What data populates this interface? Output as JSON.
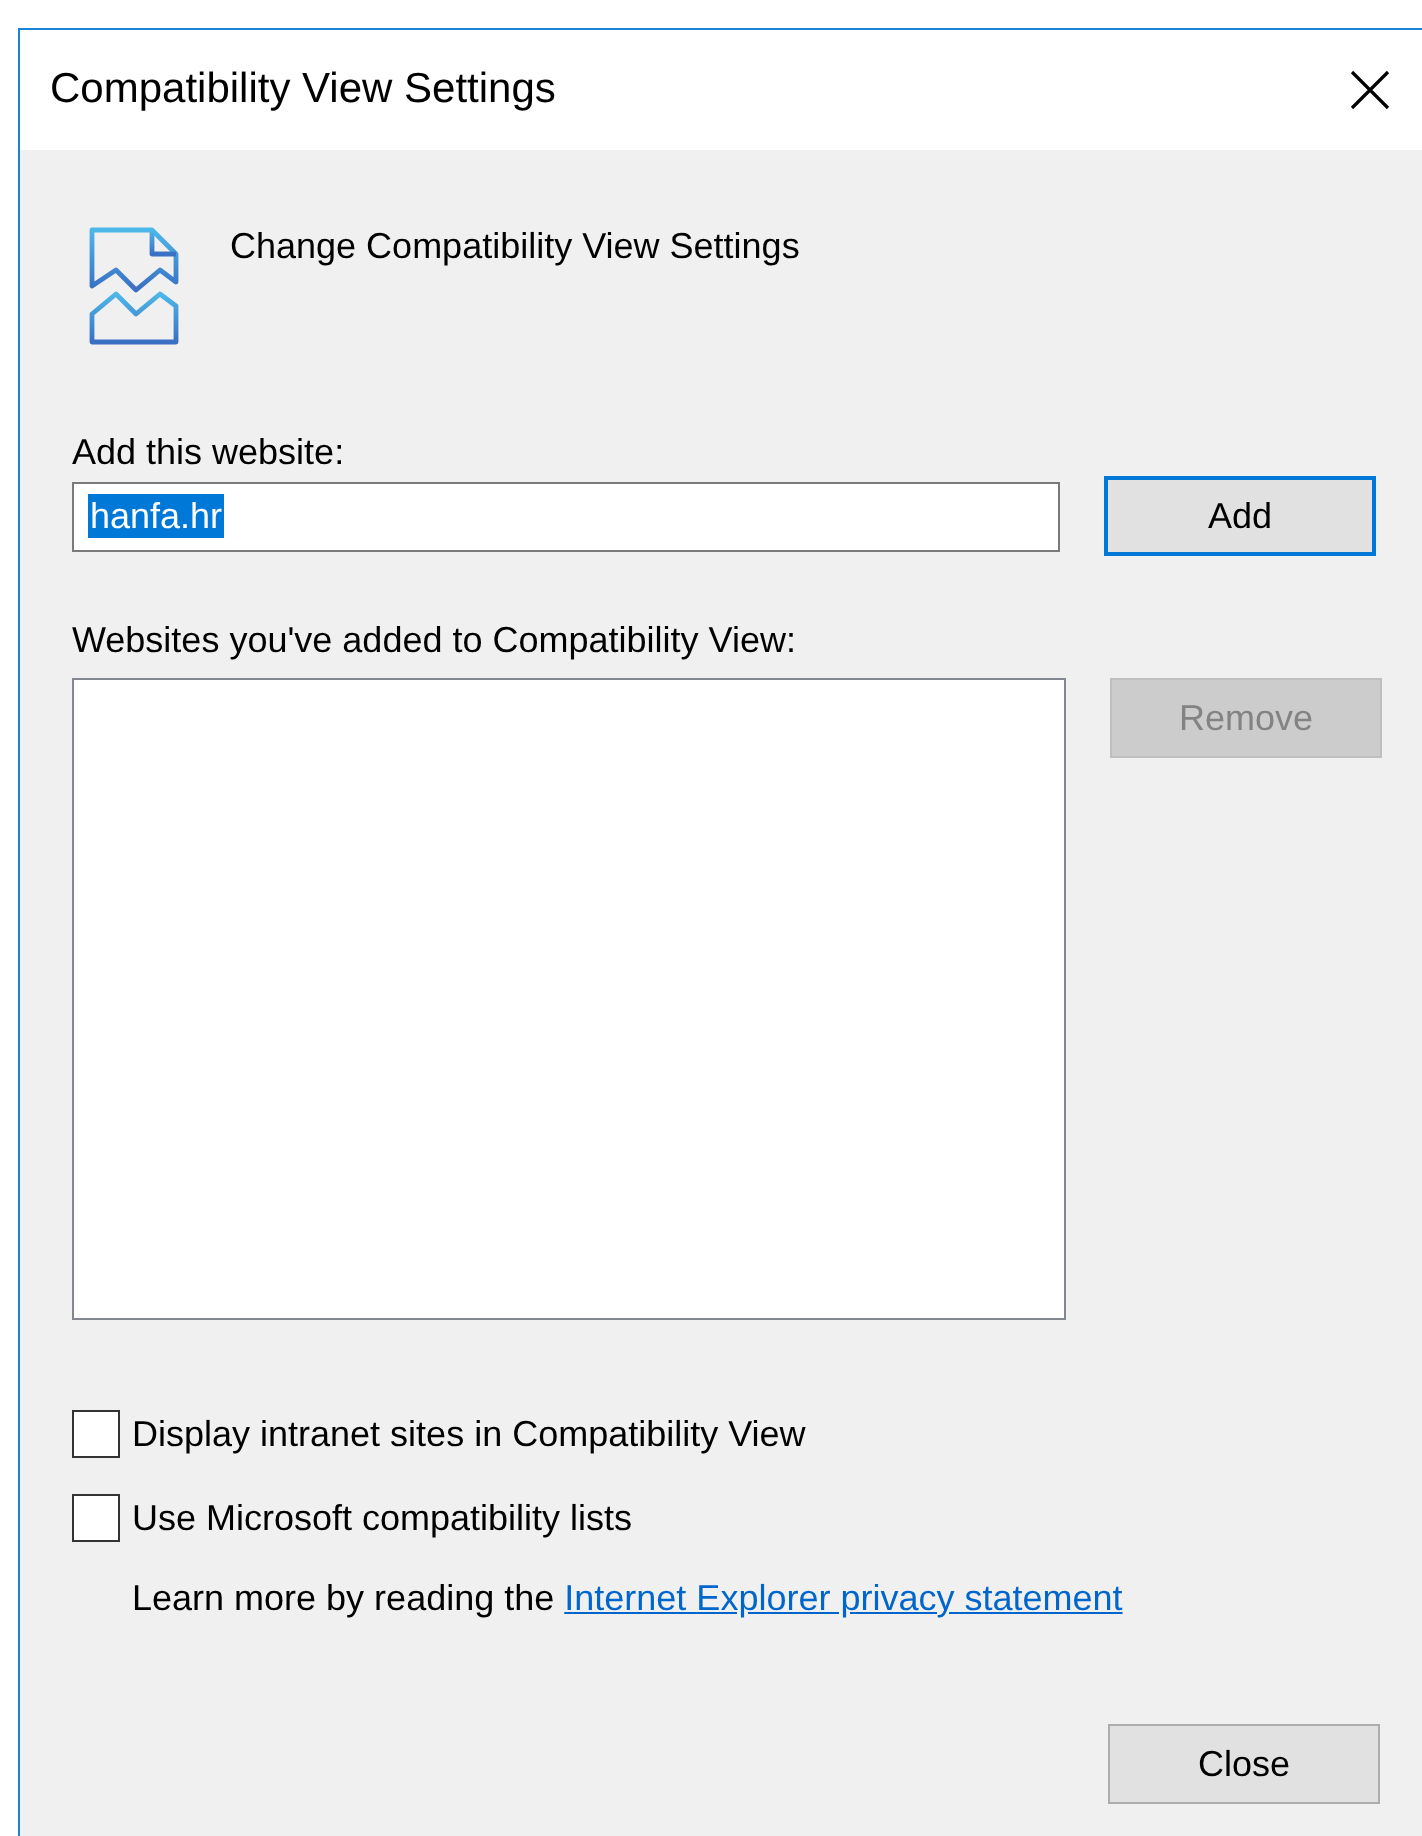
{
  "window": {
    "title": "Compatibility View Settings"
  },
  "header": {
    "text": "Change Compatibility View Settings"
  },
  "add_site": {
    "label": "Add this website:",
    "value": "hanfa.hr",
    "value_selected": true,
    "button": {
      "label": "Add",
      "default": true,
      "disabled": false
    }
  },
  "site_list": {
    "label": "Websites you've added to Compatibility View:",
    "remove_button": {
      "label": "Remove",
      "default": false,
      "disabled": true
    }
  },
  "options": [
    {
      "label": "Display intranet sites in Compatibility View",
      "checked": false
    },
    {
      "label": "Use Microsoft compatibility lists",
      "checked": false
    }
  ],
  "privacy": {
    "text": "Learn more by reading the",
    "link": "Internet Explorer privacy statement"
  },
  "close_button": {
    "label": "Close",
    "default": false,
    "disabled": false
  }
}
